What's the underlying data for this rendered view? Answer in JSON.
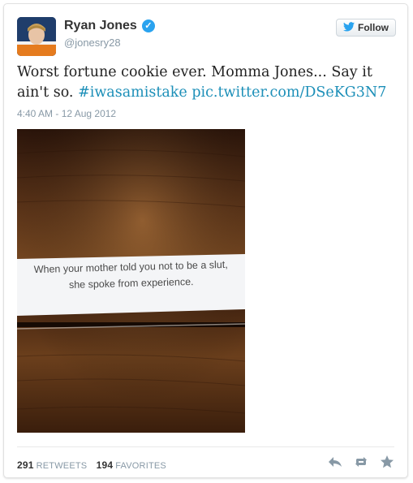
{
  "user": {
    "name": "Ryan Jones",
    "handle": "@jonesry28",
    "verified": true
  },
  "follow_button": {
    "label": "Follow",
    "icon": "twitter-bird-icon"
  },
  "tweet": {
    "text": "Worst fortune cookie ever. Momma Jones... Say it ain't so.",
    "hashtag": "#iwasamistake",
    "link": "pic.twitter.com/DSeKG3N7",
    "timestamp": "4:40 AM - 12 Aug 2012"
  },
  "photo": {
    "fortune_line1": "When your mother told you not to be a slut,",
    "fortune_line2": "she spoke from experience."
  },
  "stats": {
    "retweets_count": "291",
    "retweets_label": "RETWEETS",
    "favorites_count": "194",
    "favorites_label": "FAVORITES"
  },
  "actions": [
    "reply-icon",
    "retweet-icon",
    "favorite-icon"
  ],
  "colors": {
    "link": "#1c8fb8",
    "verified": "#2aa3ef",
    "meta_gray": "#8899a6"
  }
}
